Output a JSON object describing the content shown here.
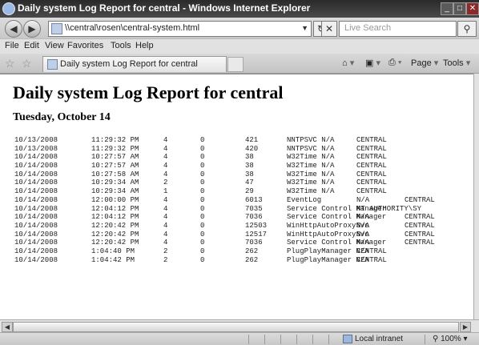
{
  "window": {
    "title": "Daily system Log Report for central - Windows Internet Explorer",
    "controls": [
      "_",
      "□",
      "✕"
    ]
  },
  "address_bar": {
    "url": "\\\\central\\rosen\\central-system.html",
    "search_placeholder": "Live Search"
  },
  "menu": [
    "File",
    "Edit",
    "View",
    "Favorites",
    "Tools",
    "Help"
  ],
  "tab": {
    "label": "Daily system Log Report for central"
  },
  "command_bar": {
    "page": "Page",
    "tools": "Tools"
  },
  "report": {
    "title": "Daily system Log Report for central",
    "subtitle": "Tuesday, October 14",
    "rows": [
      [
        "10/13/2008",
        "11:29:32 PM",
        "4",
        "0",
        "421",
        "NNTPSVC N/A",
        "CENTRAL",
        "",
        ""
      ],
      [
        "10/13/2008",
        "11:29:32 PM",
        "4",
        "0",
        "420",
        "NNTPSVC N/A",
        "CENTRAL",
        "",
        ""
      ],
      [
        "10/14/2008",
        "10:27:57 AM",
        "4",
        "0",
        "38",
        "W32Time N/A",
        "CENTRAL",
        "",
        ""
      ],
      [
        "10/14/2008",
        "10:27:57 AM",
        "4",
        "0",
        "38",
        "W32Time N/A",
        "CENTRAL",
        "",
        ""
      ],
      [
        "10/14/2008",
        "10:27:58 AM",
        "4",
        "0",
        "38",
        "W32Time N/A",
        "CENTRAL",
        "",
        ""
      ],
      [
        "10/14/2008",
        "10:29:34 AM",
        "2",
        "0",
        "47",
        "W32Time N/A",
        "CENTRAL",
        "",
        ""
      ],
      [
        "10/14/2008",
        "10:29:34 AM",
        "1",
        "0",
        "29",
        "W32Time N/A",
        "CENTRAL",
        "",
        ""
      ],
      [
        "10/14/2008",
        "12:00:00 PM",
        "4",
        "0",
        "6013",
        "EventLog",
        "N/A",
        "CENTRAL",
        ""
      ],
      [
        "10/14/2008",
        "12:04:12 PM",
        "4",
        "0",
        "7035",
        "Service Control Manager",
        "NT AUTHORITY\\SY",
        "",
        ""
      ],
      [
        "10/14/2008",
        "12:04:12 PM",
        "4",
        "0",
        "7036",
        "Service Control Manager",
        "N/A",
        "CENTRAL",
        ""
      ],
      [
        "10/14/2008",
        "12:20:42 PM",
        "4",
        "0",
        "12503",
        "WinHttpAutoProxySvc",
        "N/A",
        "CENTRAL",
        ""
      ],
      [
        "10/14/2008",
        "12:20:42 PM",
        "4",
        "0",
        "12517",
        "WinHttpAutoProxySvc",
        "N/A",
        "CENTRAL",
        ""
      ],
      [
        "10/14/2008",
        "12:20:42 PM",
        "4",
        "0",
        "7036",
        "Service Control Manager",
        "N/A",
        "CENTRAL",
        ""
      ],
      [
        "10/14/2008",
        "1:04:40 PM",
        "2",
        "0",
        "262",
        "PlugPlayManager N/A",
        "CENTRAL",
        "",
        ""
      ],
      [
        "10/14/2008",
        "1:04:42 PM",
        "2",
        "0",
        "262",
        "PlugPlayManager N/A",
        "CENTRAL",
        "",
        ""
      ]
    ]
  },
  "status_bar": {
    "zone": "Local intranet",
    "zoom": "100%"
  }
}
